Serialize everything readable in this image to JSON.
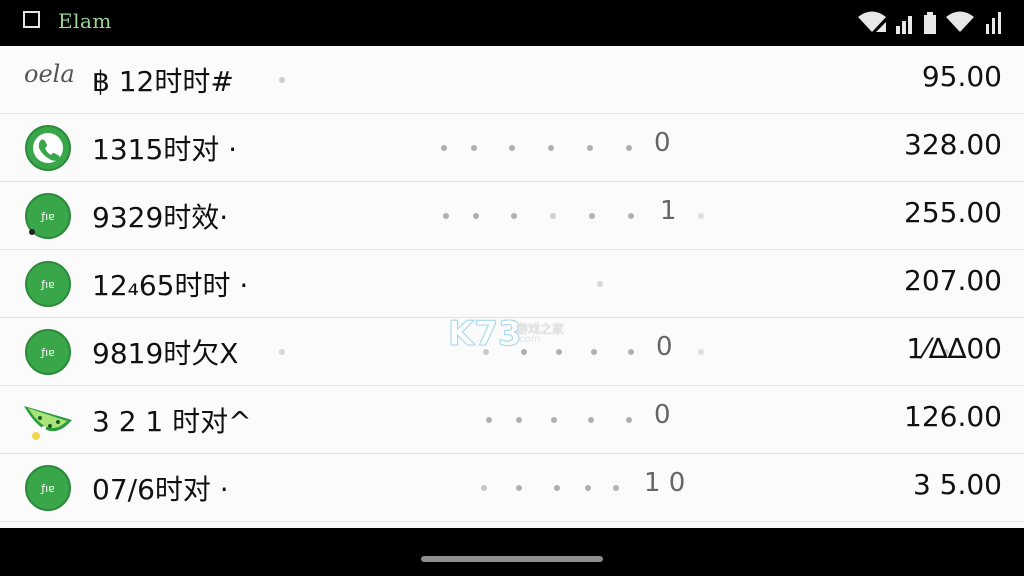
{
  "status_bar": {
    "title": "Elam",
    "icons": [
      "checkbox-square-icon",
      "wifi-icon",
      "signal-icon",
      "battery-icon",
      "signal-bars-icon"
    ]
  },
  "rows": [
    {
      "brand": "oela",
      "label": "฿ 12时时#",
      "count": "",
      "amount": "95.00",
      "icon": "brand-script-logo"
    },
    {
      "label": "1315时对 ·",
      "count": "0",
      "amount": "328.00",
      "icon": "phone-chat-icon"
    },
    {
      "label": "9329时效·",
      "count": "1",
      "amount": "255.00",
      "icon": "green-app-icon"
    },
    {
      "label": "12₄65时时 ·",
      "count": "",
      "amount": "207.00",
      "icon": "green-app-icon"
    },
    {
      "label": "9819时欠X",
      "count": "0",
      "amount": "1⁄∆∆00",
      "icon": "green-app-icon"
    },
    {
      "label": "3 2 1 时对^",
      "count": "0",
      "amount": "126.00",
      "icon": "watermelon-icon"
    },
    {
      "label": "07/6时对 ·",
      "count": "1 0",
      "amount": "3 5.00",
      "icon": "green-app-icon"
    }
  ],
  "watermark": {
    "text": "K73",
    "sub": "游戏之家",
    "url": ".com"
  },
  "colors": {
    "app_green": "#3aa64a",
    "list_bg": "#fbfbfb",
    "bar_bg": "#000000"
  }
}
